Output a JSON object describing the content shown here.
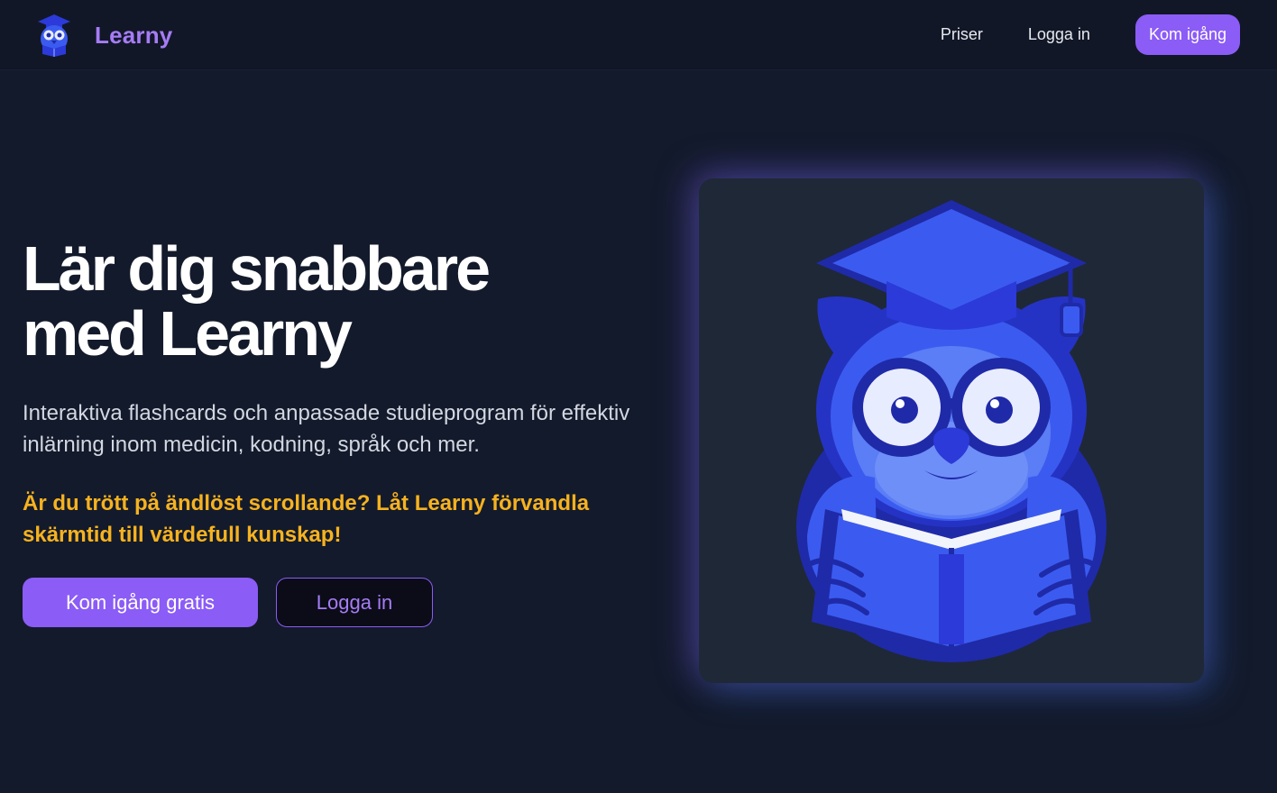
{
  "nav": {
    "brand": "Learny",
    "links": [
      "Priser",
      "Logga in"
    ],
    "cta": "Kom igång"
  },
  "hero": {
    "title_line1": "Lär dig snabbare",
    "title_line2": "med Learny",
    "description": "Interaktiva flashcards och anpassade studieprogram för effektiv inlärning inom medicin, kodning, språk och mer.",
    "highlight": "Är du trött på ändlöst scrollande? Låt Learny förvandla skärmtid till värdefull kunskap!",
    "primary_button": "Kom igång gratis",
    "secondary_button": "Logga in"
  },
  "colors": {
    "background": "#131a2b",
    "accent": "#8b5cf6",
    "highlight": "#f6b21f",
    "owl_blue": "#3b4fe0"
  },
  "icons": {
    "brand": "owl-logo-icon",
    "illustration": "owl-reading-book-illustration"
  }
}
